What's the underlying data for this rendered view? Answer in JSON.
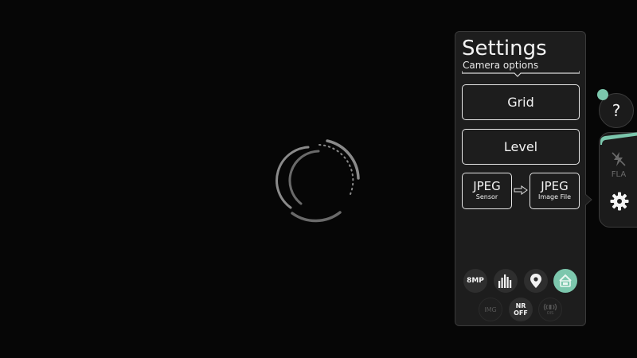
{
  "settings": {
    "title": "Settings",
    "subtitle": "Camera options",
    "grid_label": "Grid",
    "level_label": "Level",
    "format_sensor": {
      "value": "JPEG",
      "caption": "Sensor"
    },
    "format_file": {
      "value": "JPEG",
      "caption": "Image File"
    }
  },
  "quick_options": {
    "resolution": "8MP",
    "img_label": "IMG",
    "nr_line1": "NR",
    "nr_line2": "OFF",
    "ois_label": "OIS"
  },
  "side": {
    "help_label": "?",
    "flash_label": "FLA"
  },
  "icons": {
    "histogram": "histogram-icon",
    "geotag": "location-pin-icon",
    "gui": "gui-icon",
    "ois": "stabilization-icon",
    "flash": "flash-off-icon",
    "settings": "gear-icon"
  },
  "colors": {
    "accent": "#7cc7ad",
    "panel": "#1d1d1d",
    "background": "#060606"
  }
}
